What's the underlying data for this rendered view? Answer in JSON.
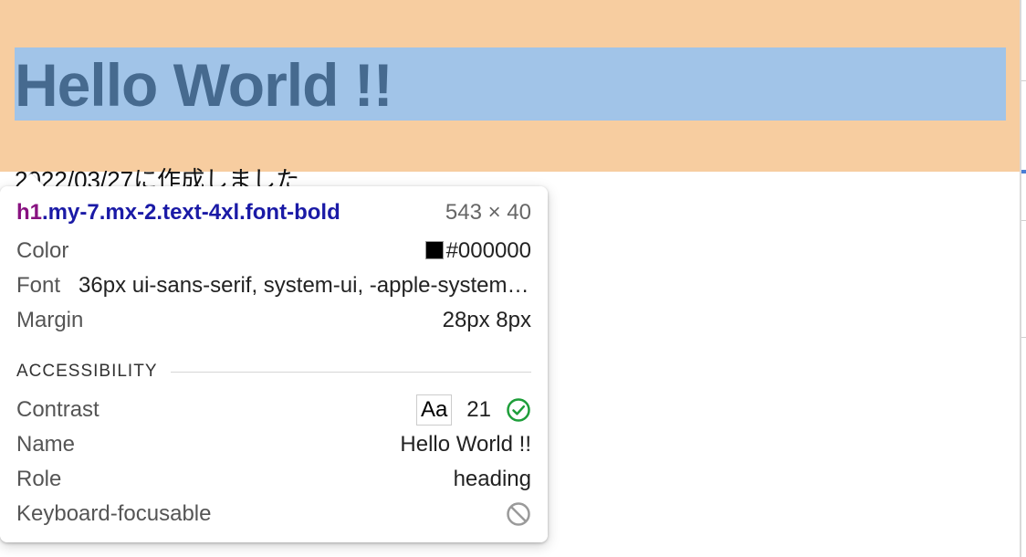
{
  "page": {
    "heading": "Hello World !!",
    "below_text": "2022/03/27に作成しました"
  },
  "inspector": {
    "tag": "h1",
    "classes": ".my-7.mx-2.text-4xl.font-bold",
    "dimensions": "543 × 40",
    "color_label": "Color",
    "color_value": "#000000",
    "font_label": "Font",
    "font_value": "36px ui-sans-serif, system-ui, -apple-system, BlinkMacSystemFont",
    "margin_label": "Margin",
    "margin_value": "28px 8px",
    "accessibility_title": "ACCESSIBILITY",
    "contrast_label": "Contrast",
    "contrast_sample": "Aa",
    "contrast_value": "21",
    "name_label": "Name",
    "name_value": "Hello World !!",
    "role_label": "Role",
    "role_value": "heading",
    "keyboard_label": "Keyboard-focusable"
  },
  "colors": {
    "margin_overlay": "#f7cda0",
    "content_overlay": "#a1c4e8",
    "pass_green": "#1e9e3a",
    "not_focusable_gray": "#9a9a9a"
  },
  "icons": {
    "contrast_status": "check-circle-icon",
    "keyboard_status": "prohibited-icon"
  }
}
